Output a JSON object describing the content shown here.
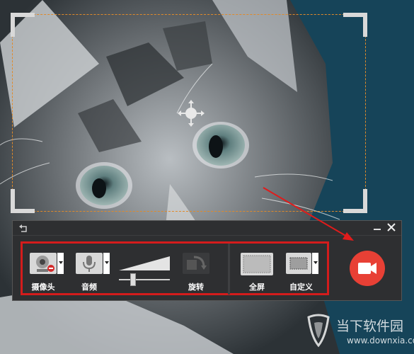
{
  "colors": {
    "selection_dash": "#e08a2a",
    "highlight_red": "#d41c1c",
    "record_button": "#e84035",
    "panel_bg": "#2e2f31",
    "sky": "#1b4d63"
  },
  "toolbar": {
    "camera_label": "摄像头",
    "audio_label": "音频",
    "rotate_label": "旋转",
    "fullscreen_label": "全屏",
    "custom_label": "自定义",
    "volume_level": 0.28
  },
  "watermark": {
    "line1": "当下软件园",
    "line2": "www.downxia.com"
  },
  "icons": {
    "move": "move-cross-icon",
    "back": "back-arrow-icon",
    "minimize": "minimize-icon",
    "close": "close-icon",
    "camera": "webcam-icon",
    "mic": "microphone-icon",
    "rotate": "rotate-icon",
    "record": "video-camera-icon"
  }
}
